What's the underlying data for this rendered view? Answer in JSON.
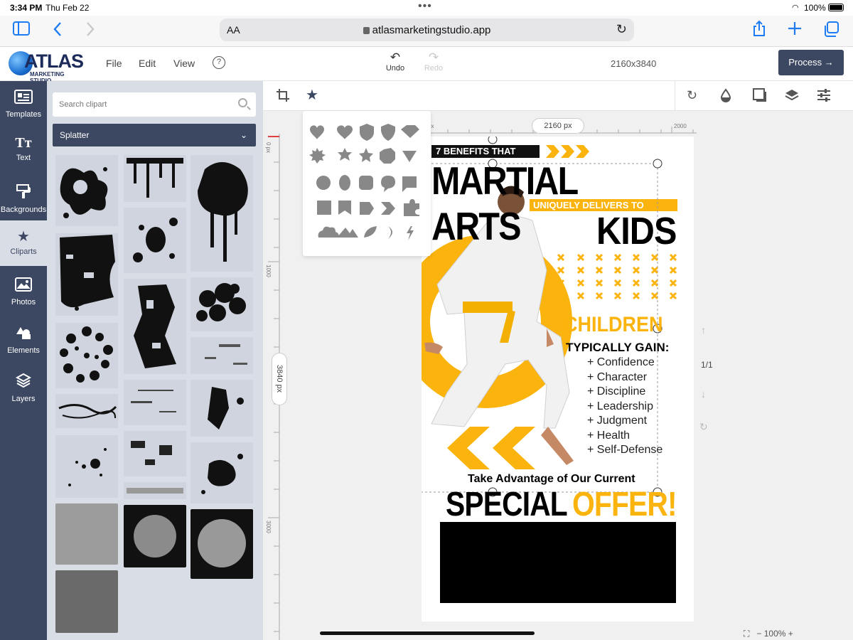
{
  "status_bar": {
    "time": "3:34 PM",
    "date": "Thu Feb 22",
    "battery": "100%"
  },
  "browser": {
    "text_size_label": "AA",
    "url": "atlasmarketingstudio.app"
  },
  "app": {
    "logo_name": "ATLAS",
    "logo_sub": "MARKETING STUDIO",
    "menu": [
      "File",
      "Edit",
      "View"
    ],
    "help": "?",
    "undo_label": "Undo",
    "redo_label": "Redo",
    "canvas_size": "2160x3840",
    "process_label": "Process →"
  },
  "rail": [
    {
      "label": "Templates",
      "icon": "templates-icon"
    },
    {
      "label": "Text",
      "icon": "text-icon"
    },
    {
      "label": "Backgrounds",
      "icon": "backgrounds-icon"
    },
    {
      "label": "Cliparts",
      "icon": "star-icon",
      "active": true
    },
    {
      "label": "Photos",
      "icon": "photos-icon"
    },
    {
      "label": "Elements",
      "icon": "elements-icon"
    },
    {
      "label": "Layers",
      "icon": "layers-icon"
    }
  ],
  "panel": {
    "search_placeholder": "Search clipart",
    "category": "Splatter"
  },
  "canvas": {
    "width_pill": "2160 px",
    "height_pill": "3840 px",
    "ruler_top_labels": [
      "px",
      "2000"
    ],
    "ruler_left_labels": [
      "0 px",
      "1000",
      "3000"
    ],
    "page_indicator": "1/1",
    "zoom": "100%"
  },
  "poster": {
    "banner": "7 BENEFITS THAT",
    "headline": "MARTIAL ARTS",
    "subheadline": "UNIQUELY DELIVERS TO",
    "kids": "KIDS",
    "children": "CHILDREN",
    "typically": "TYPICALLY GAIN:",
    "benefits": [
      "+ Confidence",
      "+ Character",
      "+ Discipline",
      "+ Leadership",
      "+ Judgment",
      "+ Health",
      "+ Self-Defense"
    ],
    "offer_line": "Take Advantage of Our Current",
    "special": "SPECIAL",
    "offer": "OFFER!"
  },
  "colors": {
    "rail_bg": "#3c4762",
    "panel_bg": "#d9dde6",
    "accent_yellow": "#fbb30d"
  }
}
